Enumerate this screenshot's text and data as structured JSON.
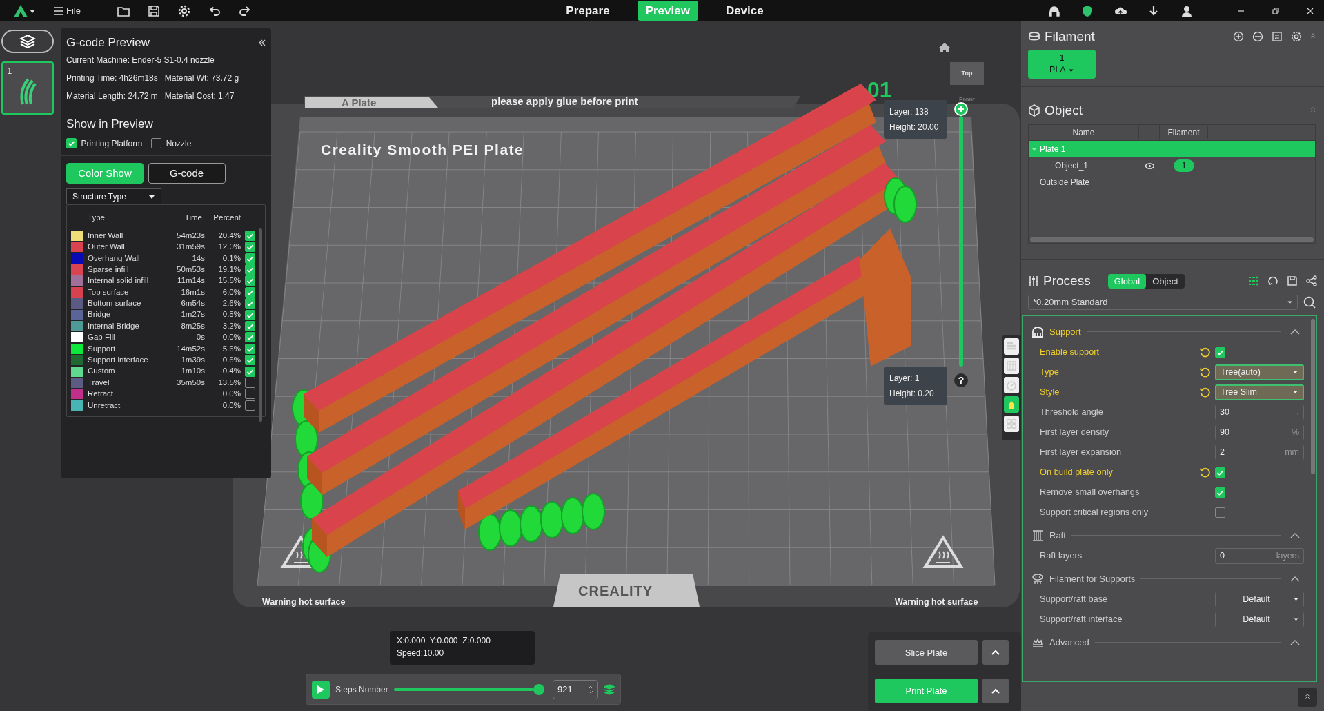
{
  "topbar": {
    "menu": "File",
    "tabs": [
      {
        "label": "Prepare",
        "selected": false
      },
      {
        "label": "Preview",
        "selected": true
      },
      {
        "label": "Device",
        "selected": false
      }
    ]
  },
  "plates": [
    {
      "number": "1",
      "selected": true
    }
  ],
  "gcode_preview": {
    "title": "G-code Preview",
    "machine": "Current Machine: Ender-5 S1-0.4 nozzle",
    "stats": [
      "Printing Time: 4h26m18s",
      "Material Wt: 73.72 g",
      "Material Length: 24.72 m",
      "Material Cost: 1.47"
    ],
    "show_title": "Show in Preview",
    "show_options": [
      {
        "label": "Printing Platform",
        "checked": true
      },
      {
        "label": "Nozzle",
        "checked": false
      }
    ],
    "view_tabs": [
      {
        "label": "Color Show",
        "selected": true
      },
      {
        "label": "G-code",
        "selected": false
      }
    ],
    "legend_dropdown": "Structure Type",
    "legend_columns": [
      "Type",
      "Time",
      "Percent"
    ],
    "legend": [
      {
        "type": "Inner Wall",
        "time": "54m23s",
        "percent": "20.4%",
        "color": "#f0dc78",
        "checked": true
      },
      {
        "type": "Outer Wall",
        "time": "31m59s",
        "percent": "12.0%",
        "color": "#d9434f",
        "checked": true
      },
      {
        "type": "Overhang Wall",
        "time": "14s",
        "percent": "0.1%",
        "color": "#0a0ab4",
        "checked": true
      },
      {
        "type": "Sparse infill",
        "time": "50m53s",
        "percent": "19.1%",
        "color": "#d94450",
        "checked": true
      },
      {
        "type": "Internal solid infill",
        "time": "11m14s",
        "percent": "15.5%",
        "color": "#a0709a",
        "checked": true
      },
      {
        "type": "Top surface",
        "time": "16m1s",
        "percent": "6.0%",
        "color": "#d8424e",
        "checked": true
      },
      {
        "type": "Bottom surface",
        "time": "6m54s",
        "percent": "2.6%",
        "color": "#5a5a82",
        "checked": true
      },
      {
        "type": "Bridge",
        "time": "1m27s",
        "percent": "0.5%",
        "color": "#5a6496",
        "checked": true
      },
      {
        "type": "Internal Bridge",
        "time": "8m25s",
        "percent": "3.2%",
        "color": "#4f9a96",
        "checked": true
      },
      {
        "type": "Gap Fill",
        "time": "0s",
        "percent": "0.0%",
        "color": "#ffffff",
        "checked": true
      },
      {
        "type": "Support",
        "time": "14m52s",
        "percent": "5.6%",
        "color": "#0ee83a",
        "checked": true
      },
      {
        "type": "Support interface",
        "time": "1m39s",
        "percent": "0.6%",
        "color": "#1e6a32",
        "checked": true
      },
      {
        "type": "Custom",
        "time": "1m10s",
        "percent": "0.4%",
        "color": "#5ed98e",
        "checked": true
      },
      {
        "type": "Travel",
        "time": "35m50s",
        "percent": "13.5%",
        "color": "#5b5b84",
        "checked": false
      },
      {
        "type": "Retract",
        "percent": "0.0%",
        "color": "#c0308a",
        "checked": false
      },
      {
        "type": "Unretract",
        "percent": "0.0%",
        "color": "#48b4b4",
        "checked": false
      }
    ]
  },
  "scene": {
    "plate_name": "A Plate",
    "plate_note": "please apply glue before print",
    "plate_type": "Creality Smooth PEI Plate",
    "brand": "CREALITY",
    "warnings": [
      "Warning hot surface",
      "Warning hot surface"
    ],
    "plate_index": "01"
  },
  "view_cube": {
    "faces": [
      "Top",
      "Front"
    ]
  },
  "layer_slider": {
    "level": 1,
    "top": [
      "Layer: 138",
      "Height: 20.00"
    ],
    "bottom": [
      "Layer: 1",
      "Height: 0.20"
    ],
    "help": "?"
  },
  "view_tools": [
    {
      "selected": false
    },
    {
      "selected": false
    },
    {
      "selected": false
    },
    {
      "selected": true
    },
    {
      "selected": false
    }
  ],
  "position": {
    "lines": [
      "X:0.000  Y:0.000  Z:0.000",
      "Speed:10.00"
    ]
  },
  "steps": {
    "label": "Steps Number",
    "level": 1,
    "value": "921"
  },
  "actions": [
    {
      "label": "Slice Plate",
      "kind": "secondary"
    },
    {
      "label": "Print Plate",
      "kind": "primary"
    }
  ],
  "filament": {
    "title": "Filament",
    "slots": [
      {
        "number": "1",
        "material": "PLA",
        "color": "#1ec85f"
      }
    ]
  },
  "object": {
    "title": "Object",
    "columns": [
      "Name",
      "Filament"
    ],
    "tree": [
      {
        "name": "Plate 1",
        "selected": true,
        "expanded": true,
        "children": [
          {
            "name": "Object_1",
            "visible": true,
            "filament": "1",
            "selected": false
          }
        ]
      },
      {
        "name": "Outside Plate",
        "selected": false
      }
    ]
  },
  "process": {
    "title": "Process",
    "scope": [
      {
        "label": "Global",
        "selected": true
      },
      {
        "label": "Object",
        "selected": false
      }
    ],
    "preset": "*0.20mm Standard",
    "groups": [
      {
        "title": "Support",
        "modified": true,
        "expanded": true,
        "rows": [
          {
            "kind": "checkbox",
            "label": "Enable support",
            "modified": true,
            "checked": true
          },
          {
            "kind": "select",
            "label": "Type",
            "modified": true,
            "value": "Tree(auto)"
          },
          {
            "kind": "select",
            "label": "Style",
            "modified": true,
            "value": "Tree Slim"
          },
          {
            "kind": "input",
            "label": "Threshold angle",
            "modified": false,
            "value": "30",
            "unit": "."
          },
          {
            "kind": "input",
            "label": "First layer density",
            "modified": false,
            "value": "90",
            "unit": "%"
          },
          {
            "kind": "input",
            "label": "First layer expansion",
            "modified": false,
            "value": "2",
            "unit": "mm"
          },
          {
            "kind": "checkbox",
            "label": "On build plate only",
            "modified": true,
            "checked": true
          },
          {
            "kind": "checkbox",
            "label": "Remove small overhangs",
            "modified": false,
            "checked": true
          },
          {
            "kind": "checkbox",
            "label": "Support critical regions only",
            "modified": false,
            "checked": false
          }
        ]
      },
      {
        "title": "Raft",
        "modified": false,
        "expanded": true,
        "rows": [
          {
            "kind": "input",
            "label": "Raft layers",
            "modified": false,
            "value": "0",
            "unit": "layers"
          }
        ]
      },
      {
        "title": "Filament for Supports",
        "modified": false,
        "expanded": true,
        "rows": [
          {
            "kind": "select",
            "label": "Support/raft base",
            "modified": false,
            "value": "Default"
          },
          {
            "kind": "select",
            "label": "Support/raft interface",
            "modified": false,
            "value": "Default"
          }
        ]
      },
      {
        "title": "Advanced",
        "modified": false,
        "expanded": true
      }
    ]
  }
}
